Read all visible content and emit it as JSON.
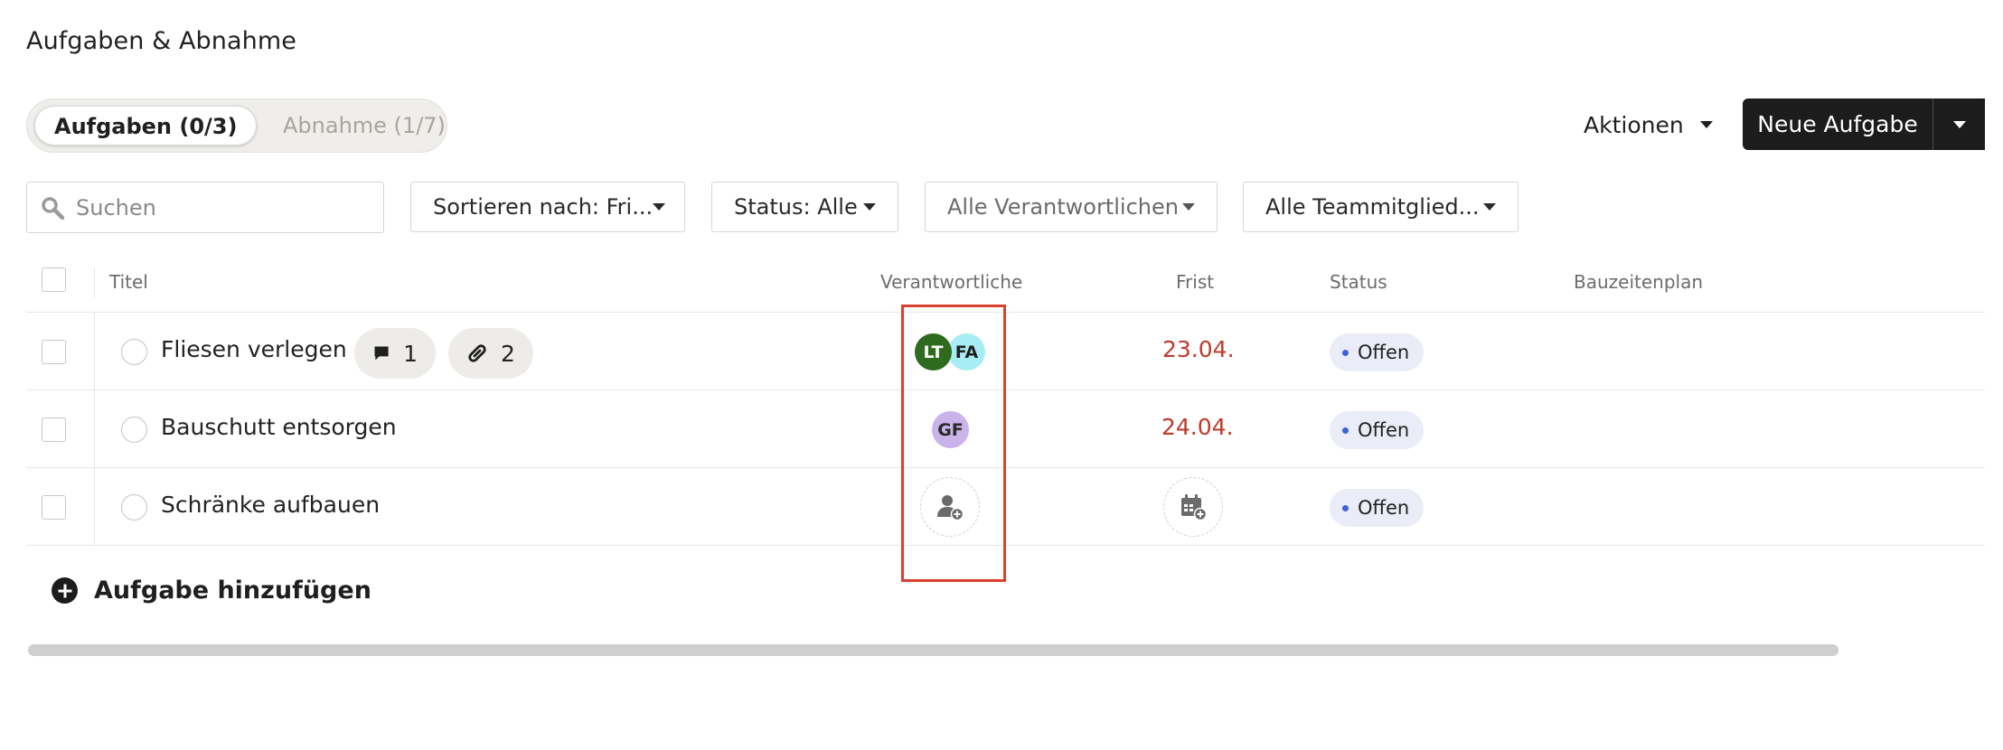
{
  "page": {
    "title": "Aufgaben & Abnahme"
  },
  "tabs": [
    {
      "label": "Aufgaben (0/3)",
      "active": true
    },
    {
      "label": "Abnahme (1/7)",
      "active": false
    }
  ],
  "toolbar": {
    "actions_label": "Aktionen",
    "new_task_label": "Neue Aufgabe"
  },
  "filters": {
    "search_placeholder": "Suchen",
    "sort_label": "Sortieren nach: Fri...",
    "status_label": "Status: Alle",
    "responsible_label": "Alle Verantwortlichen",
    "team_label": "Alle Teammitglied..."
  },
  "table": {
    "columns": {
      "title": "Titel",
      "responsible": "Verantwortliche",
      "due": "Frist",
      "status": "Status",
      "schedule": "Bauzeitenplan"
    },
    "rows": [
      {
        "title": "Fliesen verlegen",
        "comments": "1",
        "attachments": "2",
        "assignees": [
          {
            "initials": "LT",
            "bg": "#2f6b1e",
            "fg": "#ffffff"
          },
          {
            "initials": "FA",
            "bg": "#a8ecf5",
            "fg": "#1f1f1f"
          }
        ],
        "due": "23.04.",
        "status": "Offen"
      },
      {
        "title": "Bauschutt entsorgen",
        "assignees": [
          {
            "initials": "GF",
            "bg": "#c9b3ea",
            "fg": "#2a2a2a"
          }
        ],
        "due": "24.04.",
        "status": "Offen"
      },
      {
        "title": "Schränke aufbauen",
        "assignees": [],
        "due": "",
        "status": "Offen"
      }
    ]
  },
  "footer": {
    "add_task_label": "Aufgabe hinzufügen"
  },
  "colors": {
    "accent_dark": "#1c1c1c",
    "due_red": "#c0392b",
    "status_dot": "#3b63d9",
    "highlight": "#d9432e"
  },
  "icons": [
    "search-icon",
    "comment-icon",
    "attachment-icon",
    "add-person-icon",
    "add-date-icon",
    "plus-circle-icon",
    "chevron-down-icon"
  ]
}
